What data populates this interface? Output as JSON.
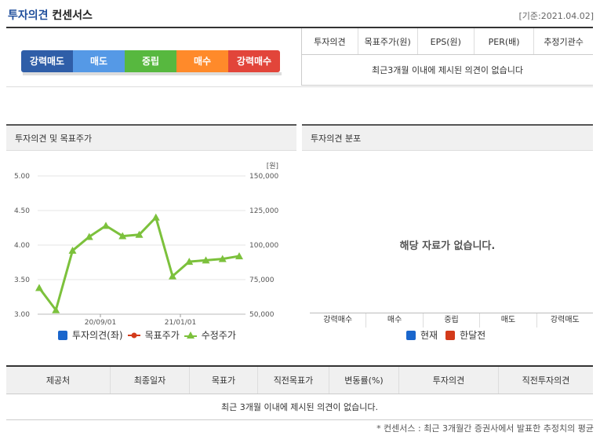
{
  "header": {
    "title_part1": "투자의견",
    "title_part2": "컨센서스",
    "date": "[기준:2021.04.02]"
  },
  "opinion_scale": [
    {
      "label": "강력매도",
      "color": "#2f5ea8"
    },
    {
      "label": "매도",
      "color": "#5599e6"
    },
    {
      "label": "중립",
      "color": "#57b83f"
    },
    {
      "label": "매수",
      "color": "#ff8a2a"
    },
    {
      "label": "강력매수",
      "color": "#e2453a"
    }
  ],
  "consensus_table": {
    "columns": [
      "투자의견",
      "목표주가(원)",
      "EPS(원)",
      "PER(배)",
      "추정기관수"
    ],
    "empty_message": "최근3개월 이내에 제시된 의견이 없습니다"
  },
  "left_panel": {
    "title": "투자의견 및 목표주가",
    "legend": [
      {
        "label": "투자의견(좌)",
        "color": "#1a66cc",
        "icon": "square-icon"
      },
      {
        "label": "목표주가",
        "color": "#d33a1a",
        "icon": "dot-line-icon"
      },
      {
        "label": "수정주가",
        "color": "#7cc13c",
        "icon": "triangle-icon"
      }
    ]
  },
  "right_panel": {
    "title": "투자의견 분포",
    "empty_message": "해당 자료가 없습니다.",
    "categories": [
      "강력매수",
      "매수",
      "중립",
      "매도",
      "강력매도"
    ],
    "legend": [
      {
        "label": "현재",
        "color": "#1a66cc"
      },
      {
        "label": "한달전",
        "color": "#d33a1a"
      }
    ]
  },
  "chart_data": {
    "type": "line",
    "title": "",
    "y_left": {
      "ticks": [
        "5.00",
        "4.50",
        "4.00",
        "3.50",
        "3.00"
      ],
      "range": [
        3.0,
        5.0
      ]
    },
    "y_right": {
      "unit": "[원]",
      "ticks": [
        "150,000",
        "125,000",
        "100,000",
        "75,000",
        "50,000"
      ],
      "range": [
        50000,
        150000
      ]
    },
    "x_ticks": [
      "20/09/01",
      "21/01/01"
    ],
    "series": [
      {
        "name": "수정주가",
        "color": "#7cc13c",
        "x": [
          "2020-07",
          "2020-08",
          "2020-09",
          "2020-10",
          "2020-11",
          "2020-12",
          "2021-01",
          "2021-02",
          "2021-03",
          "2021-04",
          "2021-05",
          "2021-06",
          "2021-07"
        ],
        "values": [
          69000,
          53000,
          96000,
          106000,
          114000,
          106500,
          107500,
          120000,
          77500,
          88000,
          89000,
          90000,
          92000
        ]
      }
    ]
  },
  "history_table": {
    "columns": [
      "제공처",
      "최종일자",
      "목표가",
      "직전목표가",
      "변동률(%)",
      "투자의견",
      "직전투자의견"
    ],
    "empty_message": "최근 3개월 이내에 제시된 의견이 없습니다."
  },
  "footnote": "* 컨센서스 : 최근 3개월간 증권사에서 발표한 추정치의 평균"
}
